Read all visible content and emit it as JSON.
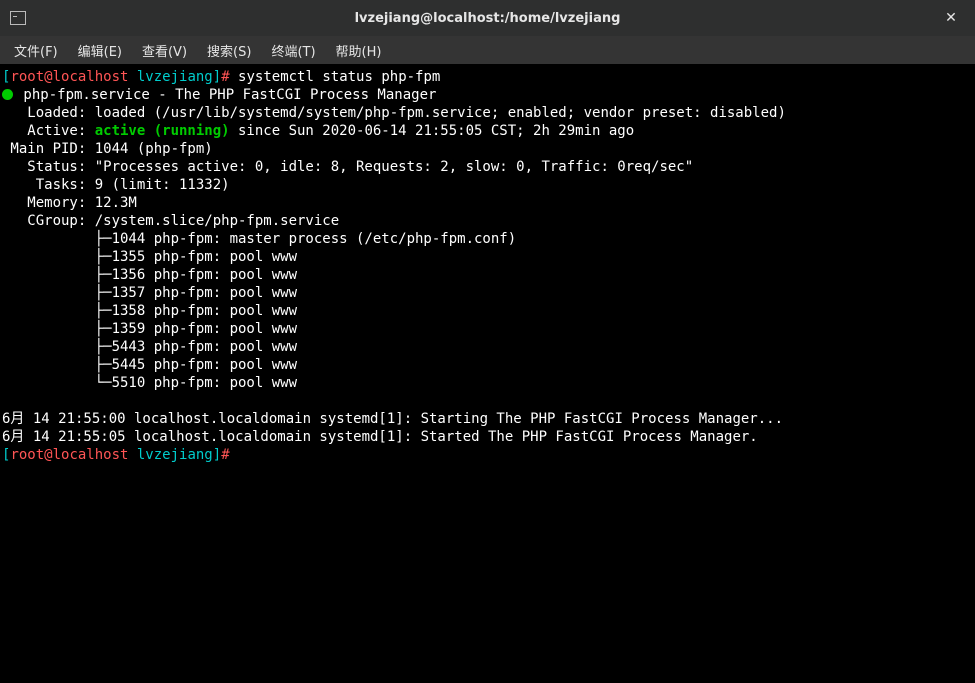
{
  "window": {
    "title": "lvzejiang@localhost:/home/lvzejiang"
  },
  "menu": {
    "file": "文件(F)",
    "edit": "编辑(E)",
    "view": "查看(V)",
    "search": "搜索(S)",
    "terminal": "终端(T)",
    "help": "帮助(H)"
  },
  "prompt1": {
    "bracket_l": "[",
    "user": "root@localhost",
    "path": " lvzejiang",
    "bracket_r": "]",
    "hash": "# ",
    "cmd": "systemctl status php-fpm"
  },
  "svc": {
    "line1_a": " php-fpm.service - The PHP FastCGI Process Manager",
    "loaded": "   Loaded: loaded (/usr/lib/systemd/system/php-fpm.service; enabled; vendor preset: disabled)",
    "active_lbl": "   Active: ",
    "active_val": "active (running)",
    "active_since": " since Sun 2020-06-14 21:55:05 CST; 2h 29min ago",
    "mainpid": " Main PID: 1044 (php-fpm)",
    "status": "   Status: \"Processes active: 0, idle: 8, Requests: 2, slow: 0, Traffic: 0req/sec\"",
    "tasks": "    Tasks: 9 (limit: 11332)",
    "memory": "   Memory: 12.3M",
    "cgroup": "   CGroup: /system.slice/php-fpm.service",
    "p1": "           ├─1044 php-fpm: master process (/etc/php-fpm.conf)",
    "p2": "           ├─1355 php-fpm: pool www",
    "p3": "           ├─1356 php-fpm: pool www",
    "p4": "           ├─1357 php-fpm: pool www",
    "p5": "           ├─1358 php-fpm: pool www",
    "p6": "           ├─1359 php-fpm: pool www",
    "p7": "           ├─5443 php-fpm: pool www",
    "p8": "           ├─5445 php-fpm: pool www",
    "p9": "           └─5510 php-fpm: pool www"
  },
  "log": {
    "l1": "6月 14 21:55:00 localhost.localdomain systemd[1]: Starting The PHP FastCGI Process Manager...",
    "l2": "6月 14 21:55:05 localhost.localdomain systemd[1]: Started The PHP FastCGI Process Manager."
  },
  "prompt2": {
    "bracket_l": "[",
    "user": "root@localhost",
    "path": " lvzejiang",
    "bracket_r": "]",
    "hash": "# "
  }
}
